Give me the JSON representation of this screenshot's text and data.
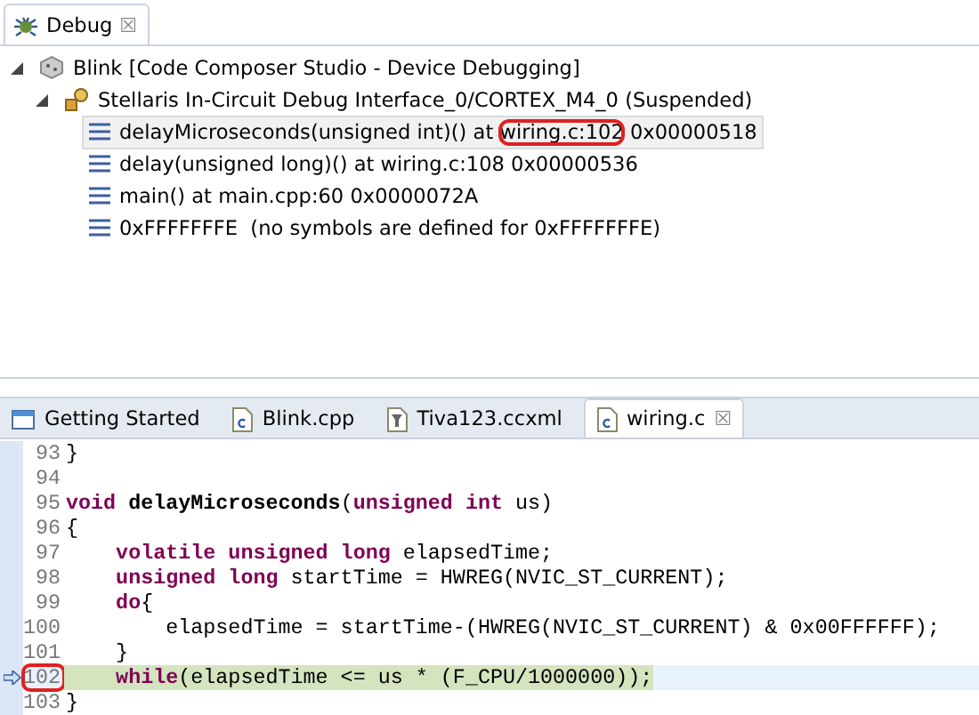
{
  "debug_view": {
    "tab": {
      "label": "Debug",
      "close": "☒",
      "selected": true
    },
    "tree": [
      {
        "label": "Blink [Code Composer Studio - Device Debugging]",
        "kind": "launch",
        "expanded": true,
        "children": [
          {
            "label": "Stellaris In-Circuit Debug Interface_0/CORTEX_M4_0 (Suspended)",
            "kind": "thread",
            "expanded": true,
            "children": [
              {
                "kind": "frame",
                "selected": true,
                "parts": [
                  {
                    "text": "delayMicroseconds(unsigned int)() at ",
                    "circled": false
                  },
                  {
                    "text": "wiring.c:102",
                    "circled": true
                  },
                  {
                    "text": " 0x00000518",
                    "circled": false
                  }
                ]
              },
              {
                "kind": "frame",
                "selected": false,
                "parts": [
                  {
                    "text": "delay(unsigned long)() at wiring.c:108 0x00000536",
                    "circled": false
                  }
                ]
              },
              {
                "kind": "frame",
                "selected": false,
                "parts": [
                  {
                    "text": "main() at main.cpp:60 0x0000072A",
                    "circled": false
                  }
                ]
              },
              {
                "kind": "frame",
                "selected": false,
                "parts": [
                  {
                    "text": "0xFFFFFFFE  (no symbols are defined for 0xFFFFFFFE)",
                    "circled": false
                  }
                ]
              }
            ]
          }
        ]
      }
    ]
  },
  "editor": {
    "tabs": [
      {
        "label": "Getting Started",
        "kind": "page",
        "selected": false
      },
      {
        "label": "Blink.cpp",
        "kind": "c-file",
        "selected": false
      },
      {
        "label": "Tiva123.ccxml",
        "kind": "config",
        "selected": false
      },
      {
        "label": "wiring.c",
        "kind": "c-file",
        "selected": true,
        "close": "☒"
      }
    ],
    "lines": [
      {
        "number": "93",
        "current": false,
        "circled": false,
        "tokens": [
          {
            "text": "}",
            "kind": "plain"
          }
        ]
      },
      {
        "number": "94",
        "current": false,
        "circled": false
      },
      {
        "number": "95",
        "current": false,
        "circled": false,
        "tokens": [
          {
            "text": "void",
            "kind": "keyword"
          },
          {
            "text": " delayMicroseconds",
            "kind": "bold"
          },
          {
            "text": "(",
            "kind": "plain"
          },
          {
            "text": "unsigned int",
            "kind": "keyword"
          },
          {
            "text": " us)",
            "kind": "plain"
          }
        ]
      },
      {
        "number": "96",
        "current": false,
        "circled": false,
        "tokens": [
          {
            "text": "{",
            "kind": "plain"
          }
        ]
      },
      {
        "number": "97",
        "current": false,
        "circled": false,
        "tokens": [
          {
            "text": "    volatile unsigned long",
            "kind": "keyword"
          },
          {
            "text": " elapsedTime;",
            "kind": "plain"
          }
        ]
      },
      {
        "number": "98",
        "current": false,
        "circled": false,
        "tokens": [
          {
            "text": "    unsigned long",
            "kind": "keyword"
          },
          {
            "text": " startTime = HWREG(NVIC_ST_CURRENT);",
            "kind": "plain"
          }
        ]
      },
      {
        "number": "99",
        "current": false,
        "circled": false,
        "tokens": [
          {
            "text": "    do",
            "kind": "keyword"
          },
          {
            "text": "{",
            "kind": "plain"
          }
        ]
      },
      {
        "number": "100",
        "current": false,
        "circled": false,
        "tokens": [
          {
            "text": "        elapsedTime = startTime-(HWREG(NVIC_ST_CURRENT) & 0x00FFFFFF);",
            "kind": "plain"
          }
        ]
      },
      {
        "number": "101",
        "current": false,
        "circled": false,
        "tokens": [
          {
            "text": "    }",
            "kind": "plain"
          }
        ]
      },
      {
        "number": "102",
        "current": true,
        "circled": true,
        "tokens": [
          {
            "text": "    while",
            "kind": "keyword"
          },
          {
            "text": "(elapsedTime <= us * (F_CPU/1000000));",
            "kind": "plain"
          }
        ]
      },
      {
        "number": "103",
        "current": false,
        "circled": false,
        "tokens": [
          {
            "text": "}",
            "kind": "plain"
          }
        ]
      }
    ]
  }
}
